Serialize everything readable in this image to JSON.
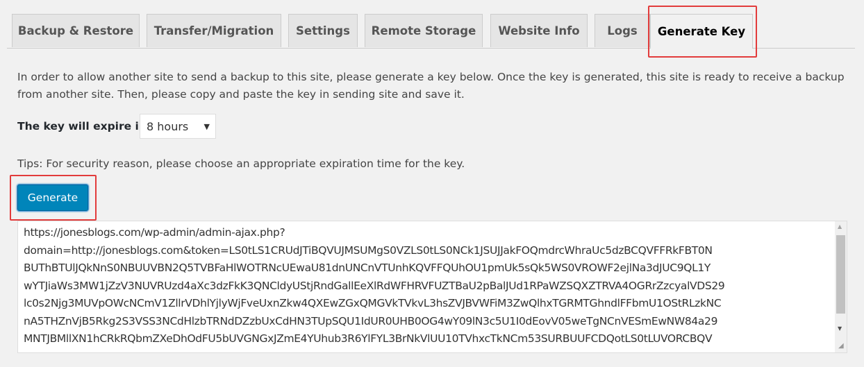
{
  "tabs": [
    {
      "label": "Backup & Restore"
    },
    {
      "label": "Transfer/Migration"
    },
    {
      "label": "Settings"
    },
    {
      "label": "Remote Storage"
    },
    {
      "label": "Website Info"
    },
    {
      "label": "Logs"
    },
    {
      "label": "Generate Key",
      "active": true
    }
  ],
  "intro_line1": "In order to allow another site to send a backup to this site, please generate a key below. Once the key is generated, this site is ready to receive a backup",
  "intro_line2": "from another site. Then, please copy and paste the key in sending site and save it.",
  "expire_label": "The key will expire in",
  "expire_value": "8 hours",
  "tips": "Tips: For security reason, please choose an appropriate expiration time for the key.",
  "generate_label": "Generate",
  "key_lines": [
    "https://jonesblogs.com/wp-admin/admin-ajax.php?",
    "domain=http://jonesblogs.com&token=LS0tLS1CRUdJTiBQVUJMSUMgS0VZLS0tLS0NCk1JSUJJakFOQmdrcWhraUc5dzBCQVFFRkFBT0N",
    "BUThBTUlJQkNnS0NBUUVBN2Q5TVBFaHlWOTRNcUEwaU81dnUNCnVTUnhKQVFFQUhOU1pmUk5sQk5WS0VROWF2ejlNa3dJUC9QL1Y",
    "wYTJiaWs3MW1jZzV3NUVRUzd4aXc3dzFkK3QNCldyUStjRndGallEeXlRdWFHRVFUZTBaU2pBalJUd1RPaWZSQXZTRVA4OGRrZzcyalVDS29",
    "lc0s2Njg3MUVpOWcNCmV1ZllrVDhlYjlyWjFveUxnZkw4QXEwZGxQMGVkTVkvL3hsZVJBVWFiM3ZwQlhxTGRMTGhndlFFbmU1OStRLzkNC",
    "nA5THZnVjB5Rkg2S3VSS3NCdHlzbTRNdDZzbUxCdHN3TUpSQU1IdUR0UHB0OG4wY09lN3c5U1I0dEovV05weTgNCnVESmEwNW84a29",
    "MNTJBMllXN1hCRkRQbmZXeDhOdFU5bUVGNGxJZmE4YUhub3R6YlFYL3BrNkVlUU10TVhxcTkNCm53SURBUUFCDQotLS0tLUVORCBQV"
  ],
  "colors": {
    "accent": "#0085ba",
    "highlight": "#e23b3b"
  }
}
